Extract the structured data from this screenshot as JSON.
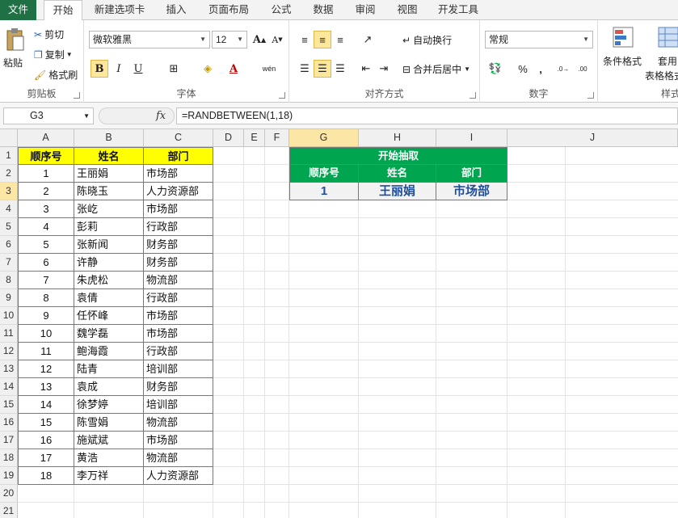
{
  "tabs": {
    "file": "文件",
    "items": [
      "开始",
      "新建选项卡",
      "插入",
      "页面布局",
      "公式",
      "数据",
      "审阅",
      "视图",
      "开发工具"
    ]
  },
  "ribbon": {
    "clipboard": {
      "paste": "粘贴",
      "cut": "剪切",
      "copy": "复制",
      "format_painter": "格式刷",
      "label": "剪贴板"
    },
    "font": {
      "name": "微软雅黑",
      "size": "12",
      "bold": "B",
      "italic": "I",
      "underline": "U",
      "color_a": "A",
      "wen": "wén",
      "grow": "A",
      "shrink": "A",
      "label": "字体"
    },
    "alignment": {
      "wrap": "自动换行",
      "merge": "合并后居中",
      "label": "对齐方式"
    },
    "number": {
      "format": "常规",
      "percent": "%",
      "comma": ",",
      "label": "数字"
    },
    "styles": {
      "conditional": "条件格式",
      "table_format_1": "套用",
      "table_format_2": "表格格式",
      "label_partial": "样式"
    }
  },
  "formula_bar": {
    "name_box": "G3",
    "fx": "fx",
    "formula": "=RANDBETWEEN(1,18)"
  },
  "columns": [
    "A",
    "B",
    "C",
    "D",
    "E",
    "F",
    "G",
    "H",
    "I",
    "J"
  ],
  "rows": [
    "1",
    "2",
    "3",
    "4",
    "5",
    "6",
    "7",
    "8",
    "9",
    "10",
    "11",
    "12",
    "13",
    "14",
    "15",
    "16",
    "17",
    "18",
    "19",
    "20",
    "21"
  ],
  "table": {
    "headers": [
      "顺序号",
      "姓名",
      "部门"
    ],
    "rows": [
      [
        "1",
        "王丽娟",
        "市场部"
      ],
      [
        "2",
        "陈晓玉",
        "人力资源部"
      ],
      [
        "3",
        "张屹",
        "市场部"
      ],
      [
        "4",
        "彭莉",
        "行政部"
      ],
      [
        "5",
        "张新闻",
        "财务部"
      ],
      [
        "6",
        "许静",
        "财务部"
      ],
      [
        "7",
        "朱虎松",
        "物流部"
      ],
      [
        "8",
        "袁倩",
        "行政部"
      ],
      [
        "9",
        "任怀峰",
        "市场部"
      ],
      [
        "10",
        "魏学磊",
        "市场部"
      ],
      [
        "11",
        "鲍海霞",
        "行政部"
      ],
      [
        "12",
        "陆青",
        "培训部"
      ],
      [
        "13",
        "袁成",
        "财务部"
      ],
      [
        "14",
        "徐梦婷",
        "培训部"
      ],
      [
        "15",
        "陈雪娟",
        "物流部"
      ],
      [
        "16",
        "施斌斌",
        "市场部"
      ],
      [
        "17",
        "黄浩",
        "物流部"
      ],
      [
        "18",
        "李万祥",
        "人力资源部"
      ]
    ]
  },
  "draw": {
    "title": "开始抽取",
    "headers": [
      "顺序号",
      "姓名",
      "部门"
    ],
    "result": [
      "1",
      "王丽娟",
      "市场部"
    ]
  },
  "colors": {
    "file_tab": "#1f7045",
    "header_yellow": "#ffff00",
    "draw_green": "#00a550",
    "result_blue": "#1f4e99"
  }
}
